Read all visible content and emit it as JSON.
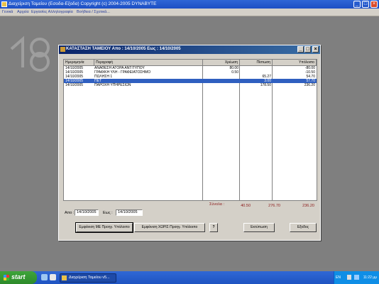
{
  "app": {
    "title": "Διαχείριση Ταμείου (Εσοδα-Εξοδα)     Copyright (c) 2004-2005 DYNABYTE",
    "menu": [
      "Γενικά",
      "Αρχεία",
      "Εργασίες Αλληλογραφία",
      "Βοήθεια / Σχετικά..."
    ]
  },
  "dialog": {
    "title": "ΚΑΤΑΣΤΑΣΗ ΤΑΜΕΙΟΥ Απο : 14/10/2005   Εως : 14/10/2005",
    "columns": [
      "Ημερομηνία",
      "Περιγραφή",
      "Χρέωση",
      "Πίστωση",
      "Υπόλοιπο"
    ],
    "rows": [
      {
        "date": "14/10/2005",
        "desc": "ΑΝΑΘΕΣΗ ΑΓΟΡΑ ΑΝΤΙΤΥΠΟΥ",
        "debit": "80.00",
        "credit": "",
        "balance": "-80.00"
      },
      {
        "date": "14/10/2005",
        "desc": "ΓΡΑΦΙΚΗ ΥΛΗ - ΓΡΑΦΕΙΑΤΟΣΗΜΟ",
        "debit": "0.50",
        "credit": "",
        "balance": "-10.50"
      },
      {
        "date": "14/10/2005",
        "desc": "ΠΩΛΗΣΗ 1",
        "debit": "",
        "credit": "65.27",
        "balance": "54.70"
      },
      {
        "date": "14/10/2005",
        "desc": "ΠΕΤ",
        "debit": "",
        "credit": "3.00",
        "balance": "57.70"
      },
      {
        "date": "14/10/2005",
        "desc": "ΠΑΡΟΧΗ ΥΠΗΡΕΣΙΩΝ",
        "debit": "",
        "credit": "178.50",
        "balance": "236.20"
      }
    ],
    "selected_row": 3,
    "totals": {
      "label": "Σύνολα :",
      "debit": "40.50",
      "credit": "276.70",
      "balance": "236.20"
    },
    "from_label": "Απο :",
    "from_value": "14/10/2005",
    "to_label": "Εως :",
    "to_value": "14/10/2005",
    "buttons": {
      "print_with": "Εμφάνιση ΜΕ Προηγ. Υπόλοιπο",
      "print_without": "Εμφάνιση ΧΩΡΙΣ Προηγ. Υπόλοιπο",
      "print": "Εκτύπωση",
      "exit": "Εξοδος",
      "help": "?"
    }
  },
  "taskbar": {
    "start": "start",
    "task": "Διαχείριση Ταμείου v5...",
    "lang": "EN",
    "clock": "11:22 μμ"
  },
  "colors": {
    "accent": "#0a246a",
    "total_text": "#8b1a1a",
    "selection": "#2f5fc0"
  }
}
